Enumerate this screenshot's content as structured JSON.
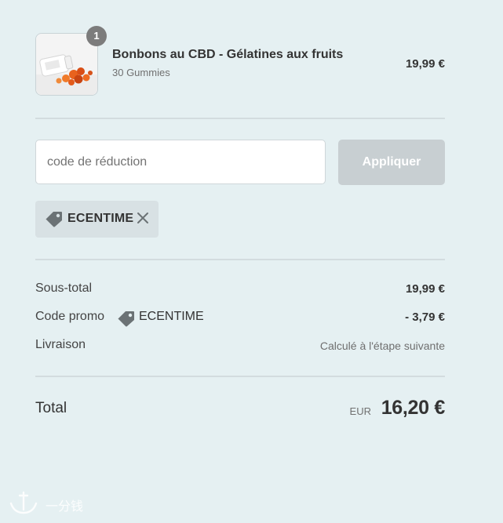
{
  "cart": {
    "item": {
      "quantity": "1",
      "name": "Bonbons au CBD - Gélatines aux fruits",
      "variant": "30 Gummies",
      "price": "19,99 €"
    }
  },
  "discount": {
    "placeholder": "code de réduction",
    "value": "",
    "apply_label": "Appliquer",
    "applied_code": "ECENTIME"
  },
  "summary": {
    "subtotal_label": "Sous-total",
    "subtotal_value": "19,99 €",
    "promo_label": "Code promo",
    "promo_code": "ECENTIME",
    "promo_value": "- 3,79 €",
    "shipping_label": "Livraison",
    "shipping_value": "Calculé à l'étape suivante",
    "total_label": "Total",
    "total_currency": "EUR",
    "total_value": "16,20 €"
  },
  "watermark": {
    "text": "一分钱"
  },
  "icons": {
    "tag": "tag-icon",
    "remove": "close-icon",
    "product": "product-thumbnail"
  },
  "colors": {
    "background": "#e5f0f2",
    "apply_button": "#c8cfd2",
    "tag_background": "#d8e1e4",
    "badge": "#7c7c7c"
  }
}
